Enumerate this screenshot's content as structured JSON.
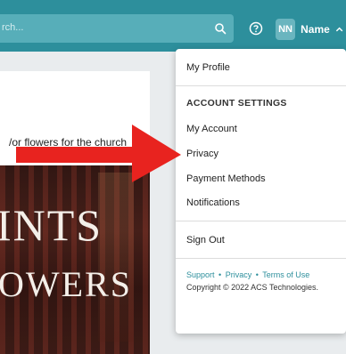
{
  "header": {
    "search_placeholder": "rch...",
    "search_icon": "search-icon",
    "help_icon": "help-circle-icon",
    "user_initials": "NN",
    "user_name": "Name",
    "chevron_icon": "chevron-up-icon",
    "colors": {
      "bar": "#2d8f9c",
      "search": "#57aeb9"
    }
  },
  "post": {
    "text": "/or flowers for the church",
    "image_text_line1": "INTS",
    "image_text_line2": "OWERS"
  },
  "annotation": {
    "icon": "red-arrow-icon",
    "color": "#e8231f"
  },
  "menu": {
    "my_profile": "My Profile",
    "account_settings_heading": "ACCOUNT SETTINGS",
    "my_account": "My Account",
    "privacy": "Privacy",
    "payment_methods": "Payment Methods",
    "notifications": "Notifications",
    "sign_out": "Sign Out",
    "footer": {
      "support": "Support",
      "privacy": "Privacy",
      "terms": "Terms of Use",
      "separator": "•",
      "copyright": "Copyright © 2022 ACS Technologies."
    }
  }
}
